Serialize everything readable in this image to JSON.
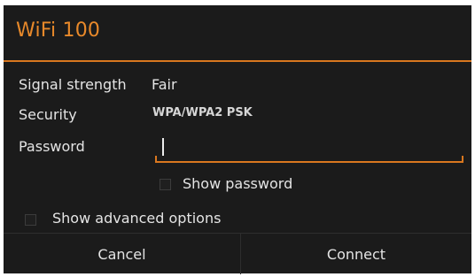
{
  "dialog": {
    "title": "WiFi 100",
    "signal_label": "Signal strength",
    "signal_value": "Fair",
    "security_label": "Security",
    "security_value": "WPA/WPA2 PSK",
    "password_label": "Password",
    "password_value": "",
    "show_password_label": "Show password",
    "show_password_checked": false,
    "show_advanced_label": "Show advanced options",
    "show_advanced_checked": false,
    "cancel_label": "Cancel",
    "connect_label": "Connect"
  },
  "colors": {
    "accent": "#d9771f",
    "title": "#e8892a",
    "background": "#1b1b1b",
    "text": "#e4e4e4"
  }
}
